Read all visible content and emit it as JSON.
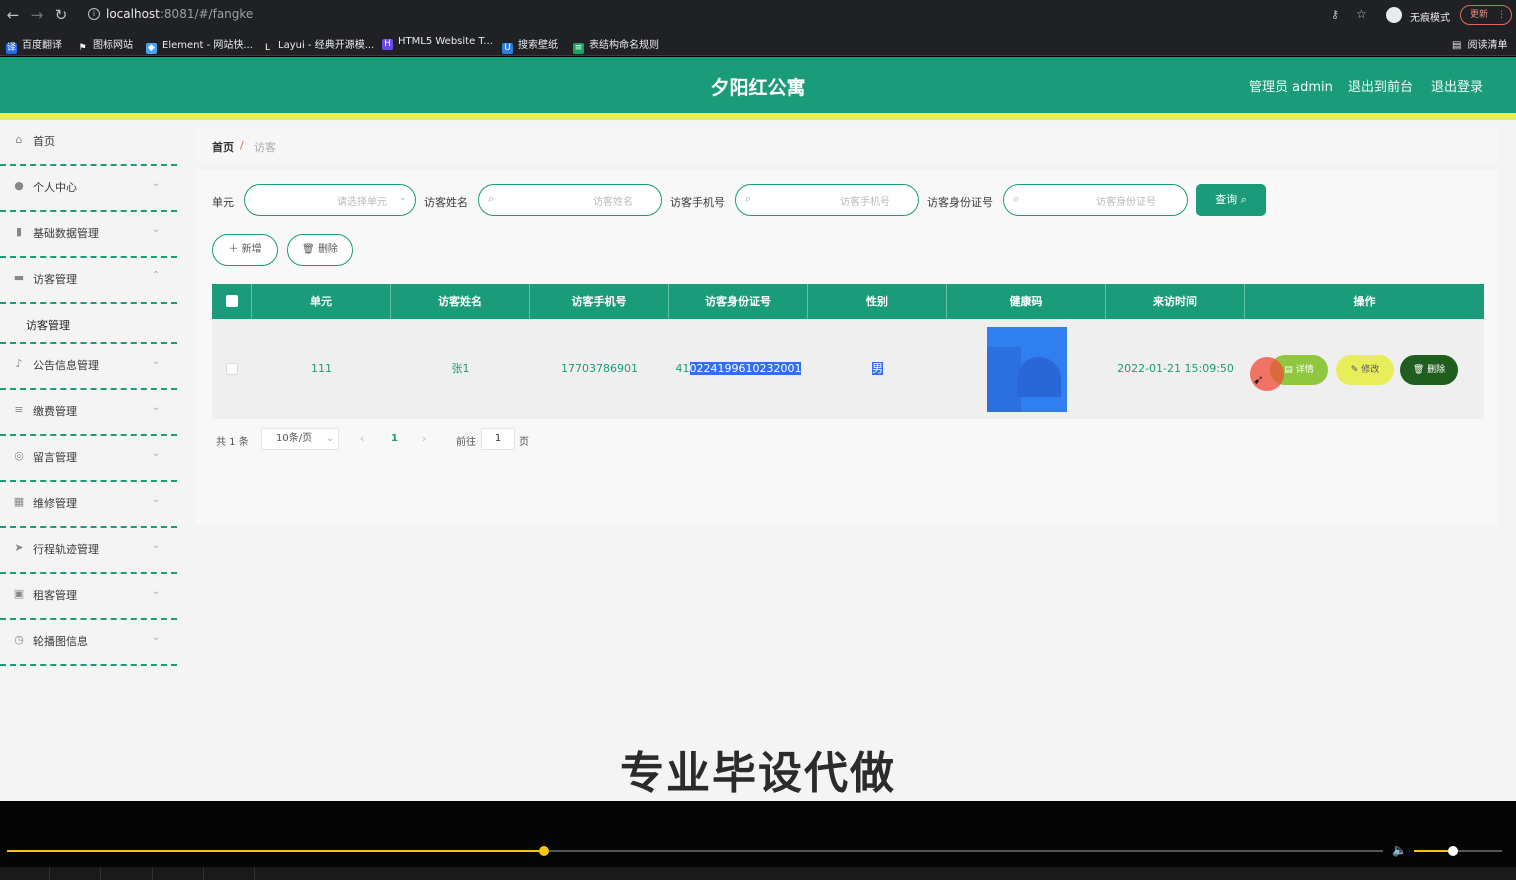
{
  "browser": {
    "url_host": "localhost",
    "url_rest": ":8081/#/fangke",
    "incognito_label": "无痕模式",
    "update_label": "更新",
    "reading_list": "阅读清单",
    "bookmarks": [
      {
        "label": "百度翻译",
        "color": "#2a6ae9",
        "glyph": "译"
      },
      {
        "label": "图标网站",
        "color": "#222222",
        "glyph": "⚑"
      },
      {
        "label": "Element - 网站快...",
        "color": "#4aa3f0",
        "glyph": "◆"
      },
      {
        "label": "Layui - 经典开源模...",
        "color": "#222222",
        "glyph": "L"
      },
      {
        "label": "HTML5 Website T...",
        "color": "#6b4ae6",
        "glyph": "H"
      },
      {
        "label": "搜索壁纸",
        "color": "#2f7fd8",
        "glyph": "U"
      },
      {
        "label": "表结构命名规则",
        "color": "#1aa260",
        "glyph": "≡"
      }
    ]
  },
  "header": {
    "title": "夕阳红公寓",
    "admin_label": "管理员 admin",
    "to_front": "退出到前台",
    "logout": "退出登录"
  },
  "sidebar": {
    "items": [
      {
        "label": "首页",
        "icon": "home-icon",
        "glyph": "⌂",
        "chevron": ""
      },
      {
        "label": "个人中心",
        "icon": "user-icon",
        "glyph": "●",
        "chevron": "⌄"
      },
      {
        "label": "基础数据管理",
        "icon": "chart-icon",
        "glyph": "▮",
        "chevron": "⌄"
      },
      {
        "label": "访客管理",
        "icon": "monitor-icon",
        "glyph": "▬",
        "chevron": "⌃"
      },
      {
        "label": "公告信息管理",
        "icon": "mic-icon",
        "glyph": "♪",
        "chevron": "⌄"
      },
      {
        "label": "缴费管理",
        "icon": "sliders-icon",
        "glyph": "≡",
        "chevron": "⌄"
      },
      {
        "label": "留言管理",
        "icon": "globe-icon",
        "glyph": "◎",
        "chevron": "⌄"
      },
      {
        "label": "维修管理",
        "icon": "grid-icon",
        "glyph": "▦",
        "chevron": "⌄"
      },
      {
        "label": "行程轨迹管理",
        "icon": "send-icon",
        "glyph": "➤",
        "chevron": "⌄"
      },
      {
        "label": "租客管理",
        "icon": "clipboard-icon",
        "glyph": "▣",
        "chevron": "⌄"
      },
      {
        "label": "轮播图信息",
        "icon": "clock-icon",
        "glyph": "◷",
        "chevron": "⌄"
      }
    ],
    "submenu_label": "访客管理"
  },
  "breadcrumb": {
    "home": "首页",
    "sep": "/",
    "current": "访客"
  },
  "filters": {
    "unit_label": "单元",
    "unit_placeholder": "请选择单元",
    "name_label": "访客姓名",
    "name_placeholder": "访客姓名",
    "phone_label": "访客手机号",
    "phone_placeholder": "访客手机号",
    "id_label": "访客身份证号",
    "id_placeholder": "访客身份证号",
    "search_label": "查询"
  },
  "toolbar": {
    "add_label": "新增",
    "delete_label": "删除"
  },
  "table": {
    "headers": [
      "单元",
      "访客姓名",
      "访客手机号",
      "访客身份证号",
      "性别",
      "健康码",
      "来访时间",
      "操作"
    ],
    "row": {
      "unit": "111",
      "name": "张1",
      "phone": "17703786901",
      "id_prefix": "41",
      "id_selected": "0224199610232001",
      "gender": "男",
      "time": "2022-01-21 15:09:50",
      "detail": "详情",
      "edit": "修改",
      "delete": "删除"
    }
  },
  "pager": {
    "total": "共 1 条",
    "page_size": "10条/页",
    "current": "1",
    "goto": "前往",
    "goto_value": "1",
    "page_unit": "页"
  },
  "caption": "专业毕设代做",
  "player": {
    "progress": 0.39,
    "volume": 0.44
  },
  "colors": {
    "primary": "#1a9b7a",
    "accent_yellow": "#e8ee5a",
    "selection": "#2f6ff0"
  }
}
